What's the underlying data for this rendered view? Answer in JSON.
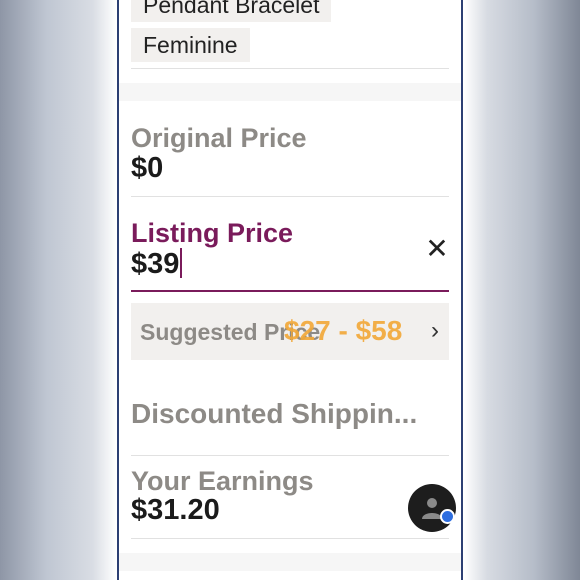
{
  "tags": {
    "top_tag": "Pendant Bracelet",
    "second_tag": "Feminine"
  },
  "original_price": {
    "label": "Original Price",
    "value": "$0"
  },
  "listing_price": {
    "label": "Listing Price",
    "value": "$39"
  },
  "suggested_price": {
    "label": "Suggested Price",
    "range": "$27 - $58"
  },
  "discounted_shipping": {
    "label": "Discounted Shippin..."
  },
  "earnings": {
    "label": "Your Earnings",
    "value": "$31.20"
  },
  "colors": {
    "accent": "#7a1b5b",
    "suggested_range": "#f2a93a",
    "muted_label": "#8d8a86"
  },
  "icons": {
    "clear": "close-icon",
    "chevron": "chevron-right-icon",
    "fab": "user-icon"
  }
}
